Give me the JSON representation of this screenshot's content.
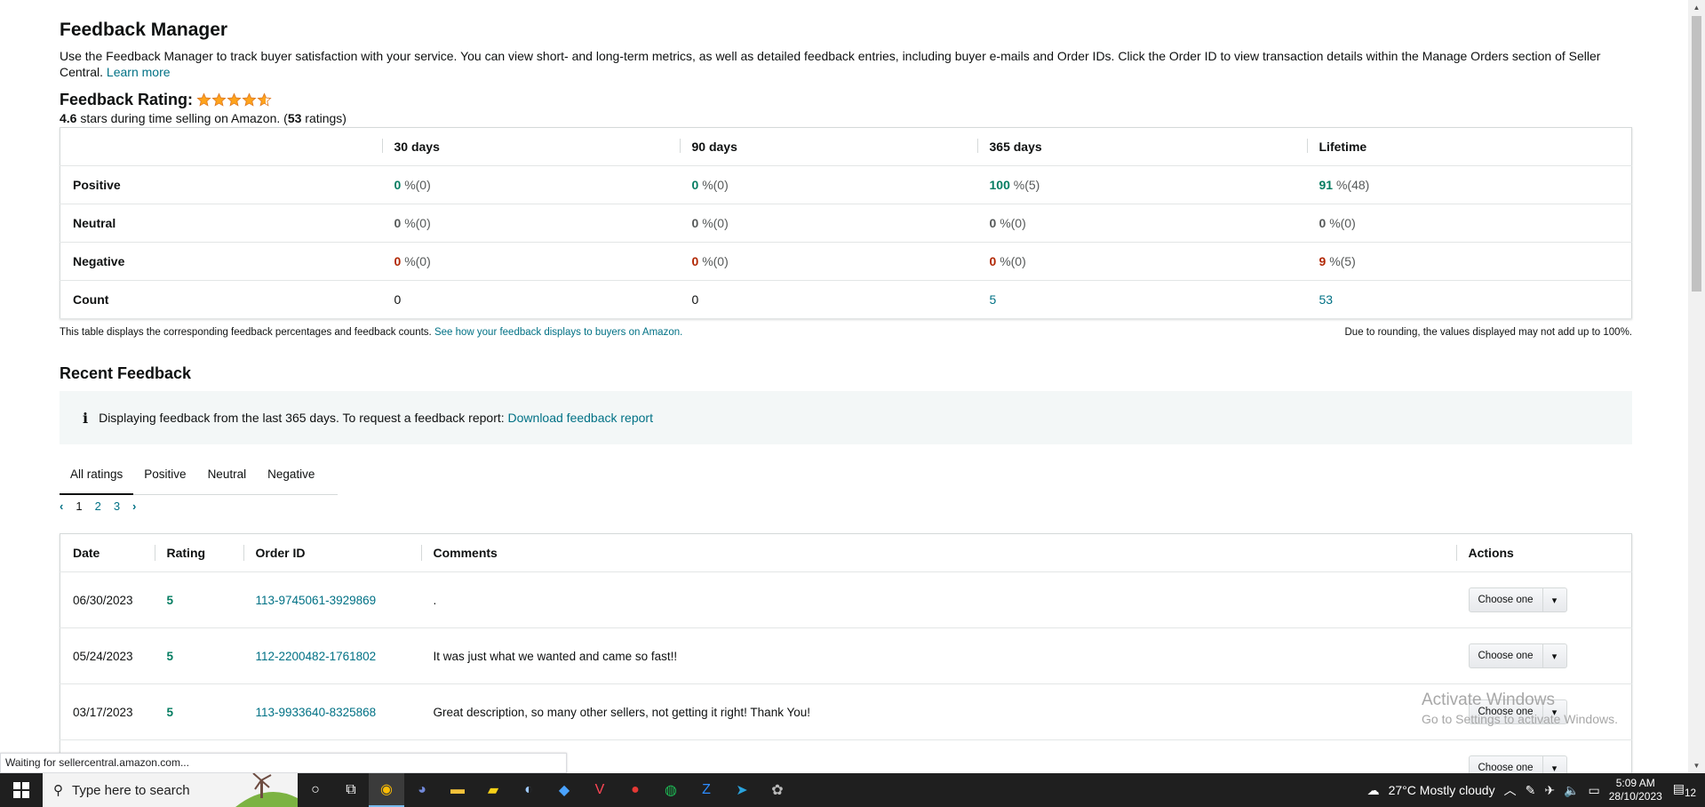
{
  "page": {
    "title": "Feedback Manager",
    "intro_text": "Use the Feedback Manager to track buyer satisfaction with your service. You can view short- and long-term metrics, as well as detailed feedback entries, including buyer e-mails and Order IDs. Click the Order ID to view transaction details within the Manage Orders section of Seller Central.",
    "learn_more": "Learn more"
  },
  "rating": {
    "label": "Feedback Rating:",
    "stars_value": 4.6,
    "stars_max": 5,
    "average": "4.6",
    "during_text": "stars during time selling on Amazon. (",
    "count": "53",
    "ratings_word": "ratings)",
    "star_color": "#ffa41c"
  },
  "metrics": {
    "columns": [
      "30 days",
      "90 days",
      "365 days",
      "Lifetime"
    ],
    "rows": [
      {
        "label": "Positive",
        "cells": [
          {
            "pct": "0",
            "rest": "%(0)"
          },
          {
            "pct": "0",
            "rest": "%(0)"
          },
          {
            "pct": "100",
            "rest": "%(5)"
          },
          {
            "pct": "91",
            "rest": "%(48)"
          }
        ]
      },
      {
        "label": "Neutral",
        "cells": [
          {
            "pct": "0",
            "rest": "%(0)"
          },
          {
            "pct": "0",
            "rest": "%(0)"
          },
          {
            "pct": "0",
            "rest": "%(0)"
          },
          {
            "pct": "0",
            "rest": "%(0)"
          }
        ]
      },
      {
        "label": "Negative",
        "cells": [
          {
            "pct": "0",
            "rest": "%(0)"
          },
          {
            "pct": "0",
            "rest": "%(0)"
          },
          {
            "pct": "0",
            "rest": "%(0)"
          },
          {
            "pct": "9",
            "rest": "%(5)"
          }
        ]
      }
    ],
    "count_row": {
      "label": "Count",
      "values": [
        "0",
        "0",
        "5",
        "53"
      ]
    },
    "note_text": "This table displays the corresponding feedback percentages and feedback counts.",
    "note_link": "See how your feedback displays to buyers on Amazon.",
    "rounding_note": "Due to rounding, the values displayed may not add up to 100%.",
    "colors": {
      "positive": "#067d62",
      "negative": "#b12704"
    }
  },
  "recent": {
    "heading": "Recent Feedback",
    "info_text": "Displaying feedback from the last 365 days. To request a feedback report:",
    "info_link": "Download feedback report",
    "tabs": [
      "All ratings",
      "Positive",
      "Neutral",
      "Negative"
    ],
    "active_tab": "All ratings",
    "pages": [
      "1",
      "2",
      "3"
    ],
    "current_page": "1",
    "prev_arrow": "‹",
    "next_arrow": "›",
    "columns": [
      "Date",
      "Rating",
      "Order ID",
      "Comments",
      "Actions"
    ],
    "rows": [
      {
        "date": "06/30/2023",
        "rating": "5",
        "order_id": "113-9745061-3929869",
        "comment": ".",
        "action": "Choose one"
      },
      {
        "date": "05/24/2023",
        "rating": "5",
        "order_id": "112-2200482-1761802",
        "comment": "It was just what we wanted and came so fast!!",
        "action": "Choose one"
      },
      {
        "date": "03/17/2023",
        "rating": "5",
        "order_id": "113-9933640-8325868",
        "comment": "Great description, so many other sellers, not getting it right! Thank You!",
        "action": "Choose one"
      },
      {
        "date": "",
        "rating": "",
        "order_id": "",
        "comment": "",
        "action": "Choose one"
      }
    ]
  },
  "watermark": {
    "line1": "Activate Windows",
    "line2": "Go to Settings to activate Windows."
  },
  "status_bar": "Waiting for sellercentral.amazon.com...",
  "taskbar": {
    "search_placeholder": "Type here to search",
    "weather": "27°C  Mostly cloudy",
    "time": "5:09 AM",
    "date": "28/10/2023",
    "notification_count": "12",
    "apps": [
      "cortana-icon",
      "task-view-icon",
      "chrome-icon",
      "discord-icon",
      "file-explorer-icon",
      "sticky-notes-icon",
      "steam-icon",
      "app-icon",
      "valorant-icon",
      "app-red-icon",
      "spotify-icon",
      "zoom-icon",
      "telegram-icon",
      "paint-icon"
    ]
  }
}
